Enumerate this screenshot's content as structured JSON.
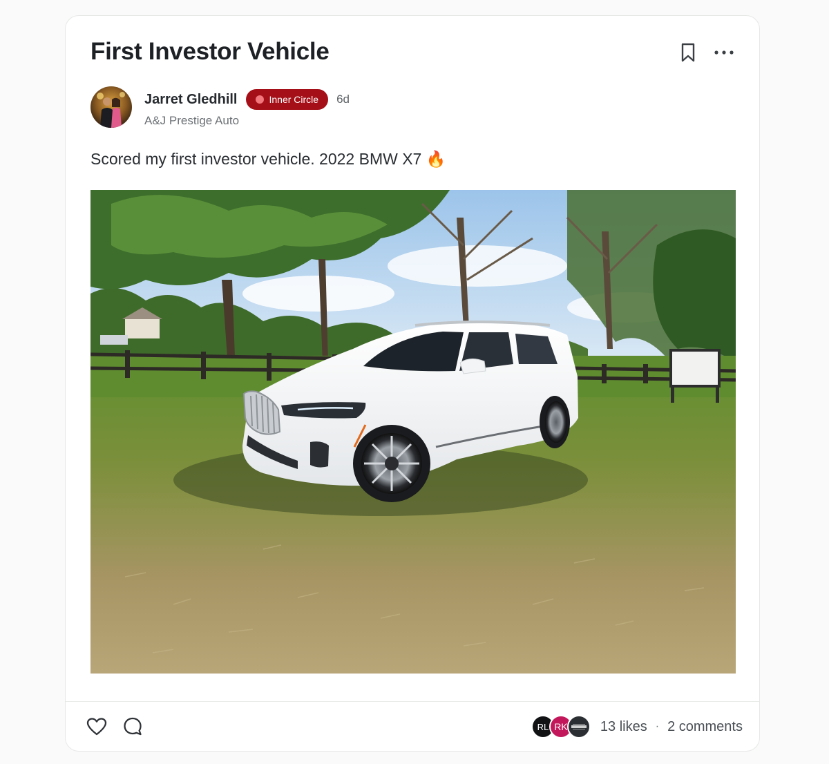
{
  "post": {
    "title": "First Investor Vehicle",
    "body": "Scored my first investor vehicle. 2022 BMW X7 🔥",
    "image_alt": "White 2022 BMW X7 parked on grass field"
  },
  "author": {
    "name": "Jarret Gledhill",
    "badge": "Inner Circle",
    "time_ago": "6d",
    "company": "A&J Prestige Auto"
  },
  "actions": {
    "bookmark_icon": "bookmark-icon",
    "more_icon": "more-horizontal-icon",
    "like_icon": "heart-icon",
    "comment_icon": "comment-icon"
  },
  "footer": {
    "likers": [
      {
        "initials": "RL",
        "color": "#101214"
      },
      {
        "initials": "RK",
        "color": "#c2185b"
      },
      {
        "initials": "",
        "color": "#2b2f33"
      }
    ],
    "likes": "13 likes",
    "separator": "·",
    "comments": "2 comments"
  },
  "colors": {
    "badge_bg": "#a50f17",
    "badge_dot": "#f2787e",
    "title": "#1d2024"
  }
}
